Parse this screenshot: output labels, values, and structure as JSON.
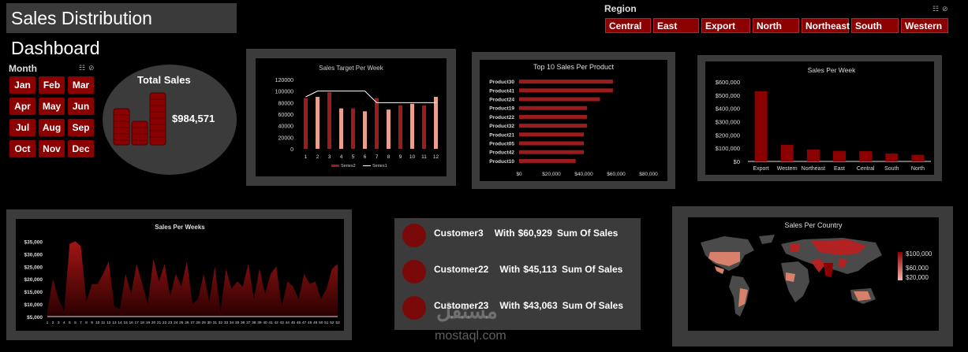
{
  "header": {
    "title": "Sales Distribution Dashboard"
  },
  "region_slicer": {
    "label": "Region",
    "items": [
      "Central",
      "East",
      "Export",
      "North",
      "Northeast",
      "South",
      "Western"
    ]
  },
  "month_slicer": {
    "label": "Month",
    "items": [
      "Jan",
      "Feb",
      "Mar",
      "Apr",
      "May",
      "Jun",
      "Jul",
      "Aug",
      "Sep",
      "Oct",
      "Nov",
      "Dec"
    ]
  },
  "total_sales": {
    "label": "Total Sales",
    "value": "$984,571"
  },
  "customers": {
    "rows": [
      {
        "name": "Customer3",
        "with": "With",
        "amount": "$60,929",
        "suffix": "Sum Of Sales"
      },
      {
        "name": "Customer22",
        "with": "With",
        "amount": "$45,113",
        "suffix": "Sum Of Sales"
      },
      {
        "name": "Customer23",
        "with": "With",
        "amount": "$43,063",
        "suffix": "Sum Of Sales"
      }
    ]
  },
  "map": {
    "title": "Sales Per Country",
    "legend": [
      "$100,000",
      "$60,000",
      "$20,000"
    ]
  },
  "watermark": {
    "text": "mostaql.com",
    "logo_text": "مستقل"
  },
  "colors": {
    "accent": "#8b0000",
    "panel": "#3b3b3b",
    "bar_light": "#e8a08a"
  },
  "chart_data": [
    {
      "id": "target",
      "type": "bar",
      "title": "Sales Target Per Week",
      "categories": [
        "1",
        "2",
        "3",
        "4",
        "5",
        "6",
        "7",
        "8",
        "9",
        "10",
        "11",
        "12"
      ],
      "series": [
        {
          "name": "Series2",
          "values": [
            88000,
            90000,
            98000,
            70000,
            70000,
            65000,
            88000,
            68000,
            75000,
            78000,
            75000,
            90000
          ]
        },
        {
          "name": "Series1",
          "values": [
            90000,
            100000,
            100000,
            100000,
            100000,
            100000,
            80000,
            80000,
            80000,
            80000,
            80000,
            80000
          ]
        }
      ],
      "yticks": [
        "0",
        "20000",
        "40000",
        "60000",
        "80000",
        "100000",
        "120000"
      ],
      "ylim": [
        0,
        120000
      ]
    },
    {
      "id": "products",
      "type": "bar",
      "orientation": "horizontal",
      "title": "Top 10 Sales Per Product",
      "categories": [
        "Product30",
        "Product41",
        "Product24",
        "Product19",
        "Product22",
        "Product32",
        "Product21",
        "Product05",
        "Product42",
        "Product10"
      ],
      "values": [
        58000,
        58000,
        50000,
        42000,
        42000,
        42000,
        40000,
        40000,
        40000,
        35000
      ],
      "xticks": [
        "$0",
        "$20,000",
        "$40,000",
        "$60,000",
        "$80,000"
      ],
      "xlim": [
        0,
        80000
      ]
    },
    {
      "id": "region",
      "type": "bar",
      "title": "Sales Per Week",
      "categories": [
        "Export",
        "Western",
        "Northeast",
        "East",
        "Central",
        "South",
        "North"
      ],
      "values": [
        530000,
        125000,
        90000,
        80000,
        78000,
        60000,
        50000
      ],
      "yticks": [
        "$0",
        "$100,000",
        "$200,000",
        "$300,000",
        "$400,000",
        "$500,000",
        "$600,000"
      ],
      "ylim": [
        0,
        600000
      ]
    },
    {
      "id": "weeks",
      "type": "area",
      "title": "Sales Per Weeks",
      "x": [
        "1",
        "2",
        "3",
        "4",
        "5",
        "6",
        "7",
        "8",
        "9",
        "10",
        "11",
        "12",
        "13",
        "14",
        "15",
        "16",
        "17",
        "18",
        "19",
        "20",
        "21",
        "22",
        "23",
        "24",
        "25",
        "26",
        "27",
        "28",
        "29",
        "30",
        "31",
        "32",
        "33",
        "34",
        "35",
        "36",
        "37",
        "38",
        "39",
        "40",
        "41",
        "42",
        "43",
        "44",
        "45",
        "46",
        "47",
        "48",
        "49",
        "50",
        "51",
        "52",
        "53"
      ],
      "values": [
        7000,
        20000,
        12000,
        7000,
        34000,
        35000,
        33000,
        11000,
        18000,
        18000,
        22000,
        27000,
        9000,
        8000,
        22000,
        14000,
        26000,
        18000,
        10000,
        28000,
        19000,
        26000,
        13000,
        22000,
        17000,
        27000,
        10000,
        12000,
        22000,
        11000,
        25000,
        7000,
        24000,
        16000,
        19000,
        17000,
        26000,
        12000,
        24000,
        14000,
        22000,
        25000,
        9000,
        19000,
        17000,
        12000,
        22000,
        18000,
        19000,
        12000,
        16000,
        24000,
        26000
      ],
      "yticks": [
        "$5,000",
        "$10,000",
        "$15,000",
        "$20,000",
        "$25,000",
        "$30,000",
        "$35,000"
      ],
      "ylim": [
        5000,
        37000
      ]
    }
  ]
}
